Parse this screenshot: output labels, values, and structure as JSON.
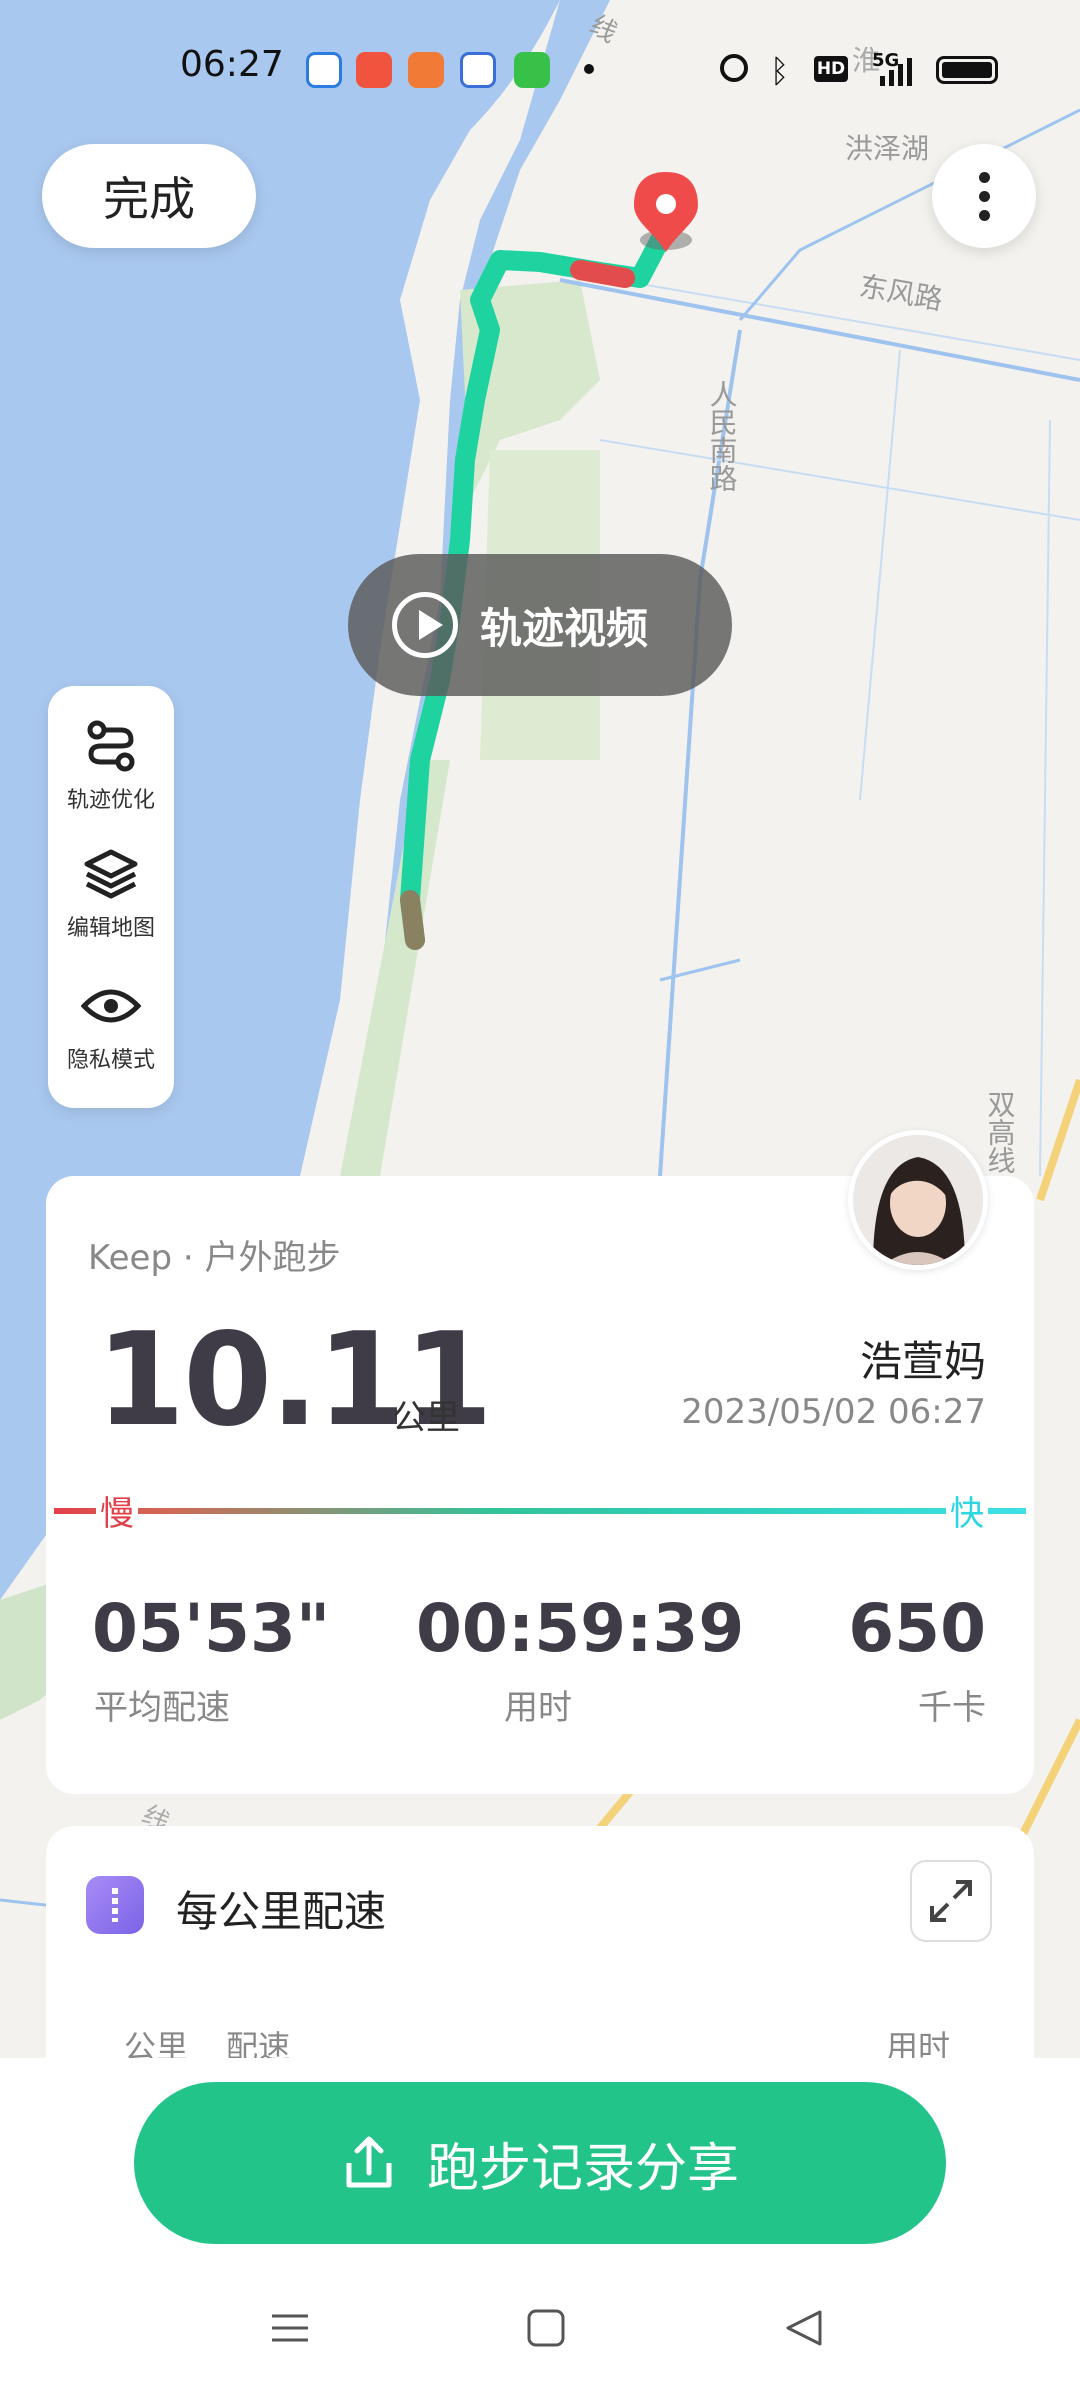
{
  "status_bar": {
    "time": "06:27",
    "network": "5G"
  },
  "map": {
    "labels": [
      "洪泽湖",
      "东风路",
      "人民南路",
      "双高线",
      "淮",
      "线",
      "线"
    ],
    "route_colors": {
      "start": "#8a8160",
      "fast": "#19d9a8",
      "mid": "#2bc79a",
      "slow": "#e05050"
    }
  },
  "top_bar": {
    "done_label": "完成"
  },
  "video_button": {
    "label": "轨迹视频"
  },
  "tools": [
    {
      "label": "轨迹优化",
      "icon": "route-icon"
    },
    {
      "label": "编辑地图",
      "icon": "layers-icon"
    },
    {
      "label": "隐私模式",
      "icon": "eye-icon"
    }
  ],
  "summary": {
    "source": "Keep · 户外跑步",
    "distance": "10.11",
    "distance_unit": "公里",
    "user_name": "浩萱妈",
    "datetime": "2023/05/02 06:27",
    "slow_label": "慢",
    "fast_label": "快",
    "stats": [
      {
        "value": "05'53\"",
        "label": "平均配速"
      },
      {
        "value": "00:59:39",
        "label": "用时"
      },
      {
        "value": "650",
        "label": "千卡"
      }
    ]
  },
  "splits": {
    "title": "每公里配速",
    "columns": [
      "公里",
      "配速",
      "用时"
    ]
  },
  "share_button": {
    "label": "跑步记录分享"
  },
  "colors": {
    "accent": "#22c48a",
    "water": "#a8c8f0",
    "land": "#f3f2ee"
  }
}
